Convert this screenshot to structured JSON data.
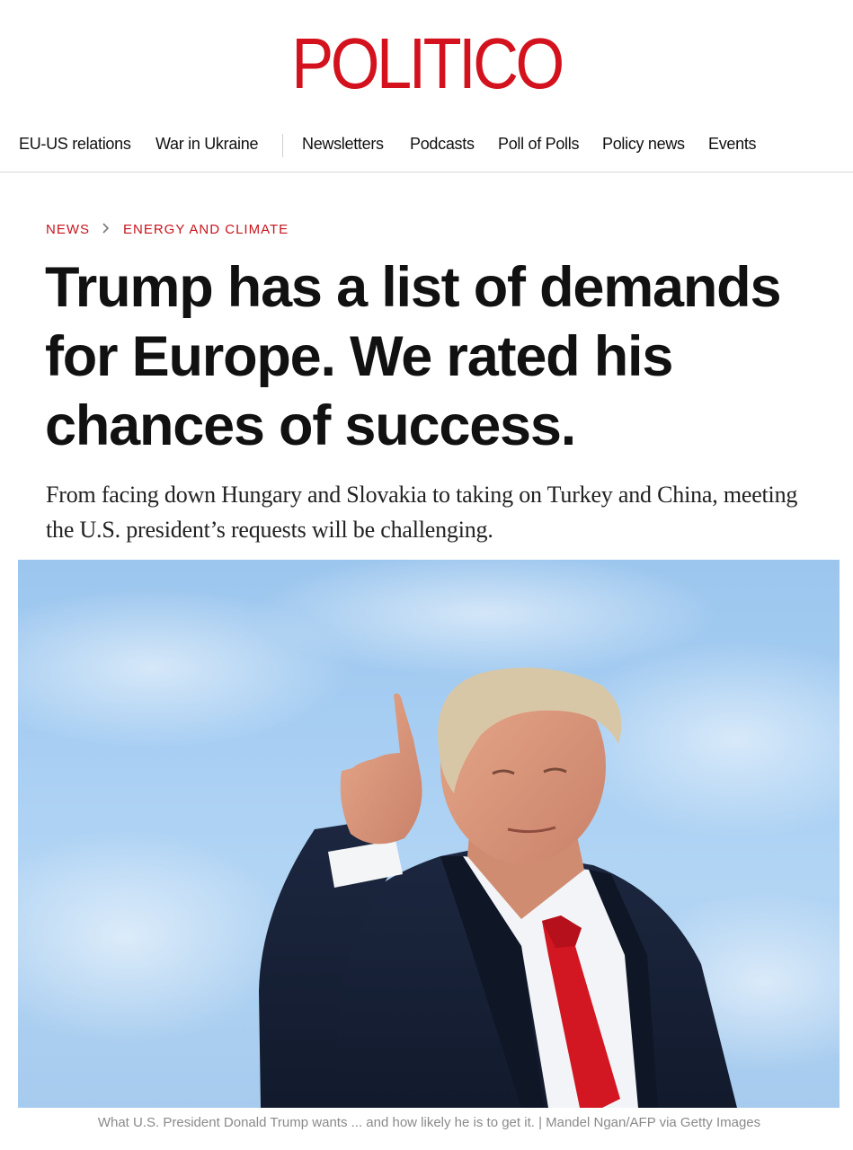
{
  "brand": {
    "logo_text": "POLITICO",
    "accent_color": "#d3121d"
  },
  "nav": {
    "items": [
      {
        "label": "EU-US relations"
      },
      {
        "label": "War in Ukraine"
      },
      {
        "label": "Newsletters"
      },
      {
        "label": "Podcasts"
      },
      {
        "label": "Poll of Polls"
      },
      {
        "label": "Policy news"
      },
      {
        "label": "Events"
      }
    ]
  },
  "breadcrumb": {
    "items": [
      {
        "label": "NEWS"
      },
      {
        "label": "ENERGY AND CLIMATE"
      }
    ],
    "separator_icon": "chevron-right-icon"
  },
  "article": {
    "headline": "Trump has a list of demands for Europe. We rated his chances of success.",
    "dek": "From facing down Hungary and Slovakia to taking on Turkey and China, meeting the U.S. president’s requests will be challenging.",
    "image_caption": "What U.S. President Donald Trump wants ... and how likely he is to get it. | Mandel Ngan/AFP via Getty Images"
  }
}
